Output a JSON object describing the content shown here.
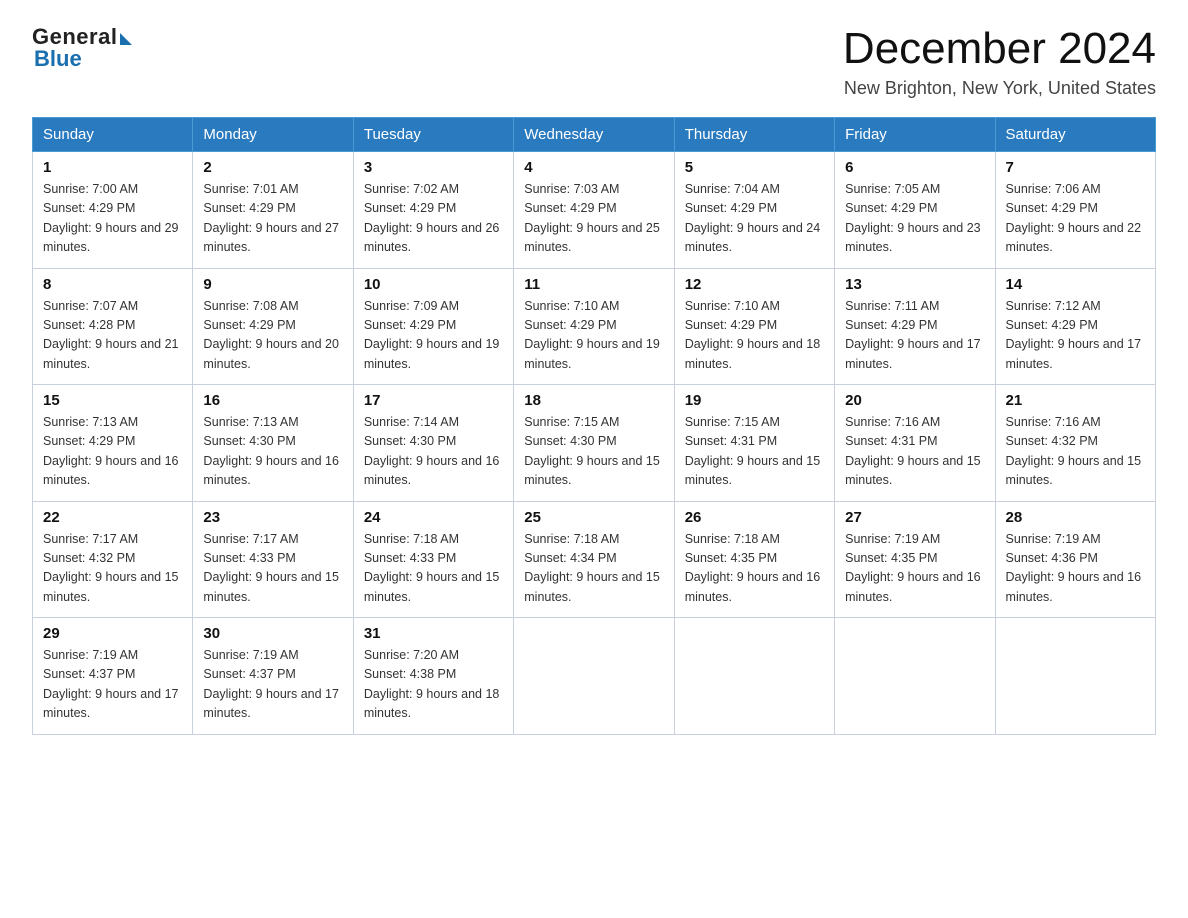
{
  "header": {
    "logo_general": "General",
    "logo_blue": "Blue",
    "month_year": "December 2024",
    "location": "New Brighton, New York, United States"
  },
  "days_of_week": [
    "Sunday",
    "Monday",
    "Tuesday",
    "Wednesday",
    "Thursday",
    "Friday",
    "Saturday"
  ],
  "weeks": [
    [
      {
        "day": "1",
        "sunrise": "7:00 AM",
        "sunset": "4:29 PM",
        "daylight": "9 hours and 29 minutes."
      },
      {
        "day": "2",
        "sunrise": "7:01 AM",
        "sunset": "4:29 PM",
        "daylight": "9 hours and 27 minutes."
      },
      {
        "day": "3",
        "sunrise": "7:02 AM",
        "sunset": "4:29 PM",
        "daylight": "9 hours and 26 minutes."
      },
      {
        "day": "4",
        "sunrise": "7:03 AM",
        "sunset": "4:29 PM",
        "daylight": "9 hours and 25 minutes."
      },
      {
        "day": "5",
        "sunrise": "7:04 AM",
        "sunset": "4:29 PM",
        "daylight": "9 hours and 24 minutes."
      },
      {
        "day": "6",
        "sunrise": "7:05 AM",
        "sunset": "4:29 PM",
        "daylight": "9 hours and 23 minutes."
      },
      {
        "day": "7",
        "sunrise": "7:06 AM",
        "sunset": "4:29 PM",
        "daylight": "9 hours and 22 minutes."
      }
    ],
    [
      {
        "day": "8",
        "sunrise": "7:07 AM",
        "sunset": "4:28 PM",
        "daylight": "9 hours and 21 minutes."
      },
      {
        "day": "9",
        "sunrise": "7:08 AM",
        "sunset": "4:29 PM",
        "daylight": "9 hours and 20 minutes."
      },
      {
        "day": "10",
        "sunrise": "7:09 AM",
        "sunset": "4:29 PM",
        "daylight": "9 hours and 19 minutes."
      },
      {
        "day": "11",
        "sunrise": "7:10 AM",
        "sunset": "4:29 PM",
        "daylight": "9 hours and 19 minutes."
      },
      {
        "day": "12",
        "sunrise": "7:10 AM",
        "sunset": "4:29 PM",
        "daylight": "9 hours and 18 minutes."
      },
      {
        "day": "13",
        "sunrise": "7:11 AM",
        "sunset": "4:29 PM",
        "daylight": "9 hours and 17 minutes."
      },
      {
        "day": "14",
        "sunrise": "7:12 AM",
        "sunset": "4:29 PM",
        "daylight": "9 hours and 17 minutes."
      }
    ],
    [
      {
        "day": "15",
        "sunrise": "7:13 AM",
        "sunset": "4:29 PM",
        "daylight": "9 hours and 16 minutes."
      },
      {
        "day": "16",
        "sunrise": "7:13 AM",
        "sunset": "4:30 PM",
        "daylight": "9 hours and 16 minutes."
      },
      {
        "day": "17",
        "sunrise": "7:14 AM",
        "sunset": "4:30 PM",
        "daylight": "9 hours and 16 minutes."
      },
      {
        "day": "18",
        "sunrise": "7:15 AM",
        "sunset": "4:30 PM",
        "daylight": "9 hours and 15 minutes."
      },
      {
        "day": "19",
        "sunrise": "7:15 AM",
        "sunset": "4:31 PM",
        "daylight": "9 hours and 15 minutes."
      },
      {
        "day": "20",
        "sunrise": "7:16 AM",
        "sunset": "4:31 PM",
        "daylight": "9 hours and 15 minutes."
      },
      {
        "day": "21",
        "sunrise": "7:16 AM",
        "sunset": "4:32 PM",
        "daylight": "9 hours and 15 minutes."
      }
    ],
    [
      {
        "day": "22",
        "sunrise": "7:17 AM",
        "sunset": "4:32 PM",
        "daylight": "9 hours and 15 minutes."
      },
      {
        "day": "23",
        "sunrise": "7:17 AM",
        "sunset": "4:33 PM",
        "daylight": "9 hours and 15 minutes."
      },
      {
        "day": "24",
        "sunrise": "7:18 AM",
        "sunset": "4:33 PM",
        "daylight": "9 hours and 15 minutes."
      },
      {
        "day": "25",
        "sunrise": "7:18 AM",
        "sunset": "4:34 PM",
        "daylight": "9 hours and 15 minutes."
      },
      {
        "day": "26",
        "sunrise": "7:18 AM",
        "sunset": "4:35 PM",
        "daylight": "9 hours and 16 minutes."
      },
      {
        "day": "27",
        "sunrise": "7:19 AM",
        "sunset": "4:35 PM",
        "daylight": "9 hours and 16 minutes."
      },
      {
        "day": "28",
        "sunrise": "7:19 AM",
        "sunset": "4:36 PM",
        "daylight": "9 hours and 16 minutes."
      }
    ],
    [
      {
        "day": "29",
        "sunrise": "7:19 AM",
        "sunset": "4:37 PM",
        "daylight": "9 hours and 17 minutes."
      },
      {
        "day": "30",
        "sunrise": "7:19 AM",
        "sunset": "4:37 PM",
        "daylight": "9 hours and 17 minutes."
      },
      {
        "day": "31",
        "sunrise": "7:20 AM",
        "sunset": "4:38 PM",
        "daylight": "9 hours and 18 minutes."
      },
      null,
      null,
      null,
      null
    ]
  ]
}
